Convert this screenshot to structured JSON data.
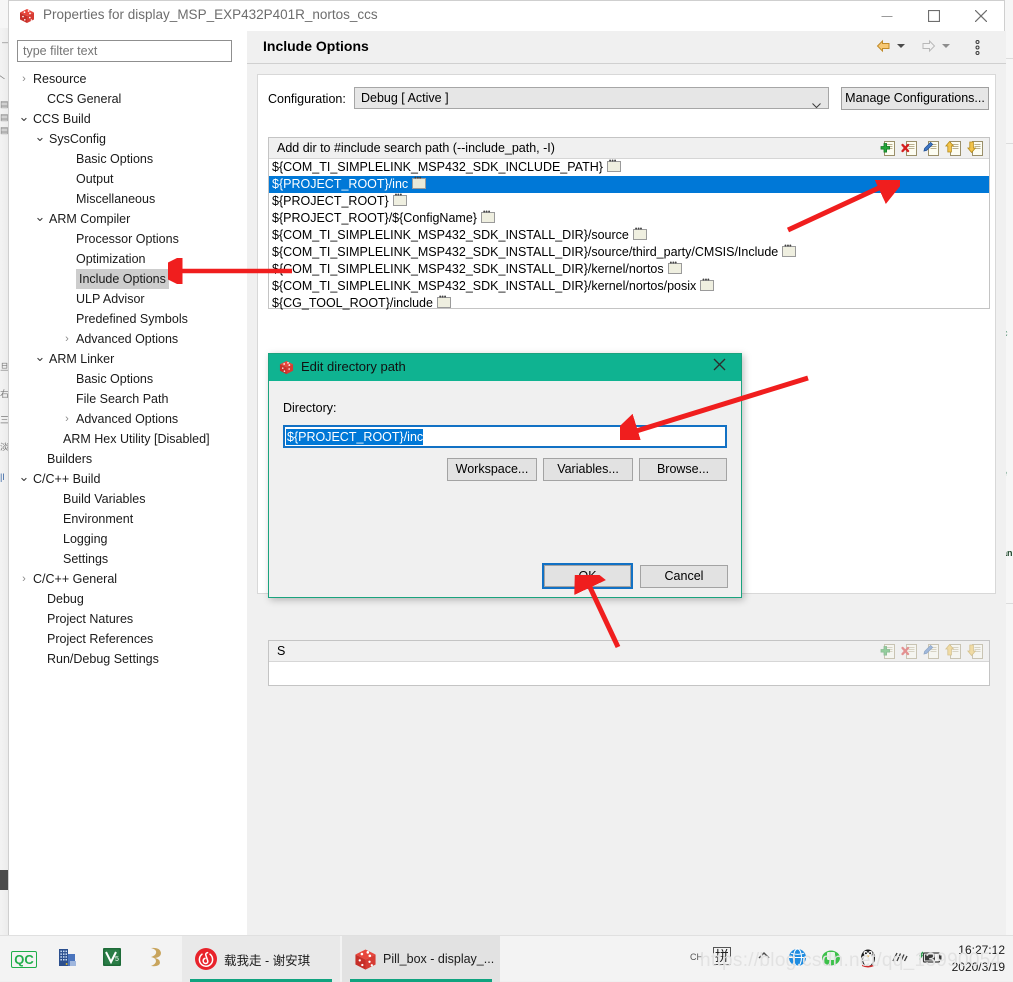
{
  "window": {
    "title": "Properties for display_MSP_EXP432P401R_nortos_ccs",
    "icon": "ccs-cube-icon",
    "minimize_label": "Minimize",
    "maximize_label": "Maximize",
    "close_label": "Close"
  },
  "filter": {
    "placeholder": "type filter text",
    "value": ""
  },
  "tree": [
    {
      "label": "Resource",
      "indent": 24,
      "twisty": "›",
      "selected": false
    },
    {
      "label": "CCS General",
      "indent": 38,
      "twisty": "",
      "selected": false
    },
    {
      "label": "CCS Build",
      "indent": 24,
      "twisty": "⌄",
      "selected": false
    },
    {
      "label": "SysConfig",
      "indent": 40,
      "twisty": "⌄",
      "selected": false
    },
    {
      "label": "Basic Options",
      "indent": 67,
      "twisty": "",
      "selected": false
    },
    {
      "label": "Output",
      "indent": 67,
      "twisty": "",
      "selected": false
    },
    {
      "label": "Miscellaneous",
      "indent": 67,
      "twisty": "",
      "selected": false
    },
    {
      "label": "ARM Compiler",
      "indent": 40,
      "twisty": "⌄",
      "selected": false
    },
    {
      "label": "Processor Options",
      "indent": 67,
      "twisty": "",
      "selected": false
    },
    {
      "label": "Optimization",
      "indent": 67,
      "twisty": "",
      "selected": false
    },
    {
      "label": "Include Options",
      "indent": 67,
      "twisty": "",
      "selected": true
    },
    {
      "label": "ULP Advisor",
      "indent": 67,
      "twisty": "",
      "selected": false
    },
    {
      "label": "Predefined Symbols",
      "indent": 67,
      "twisty": "",
      "selected": false
    },
    {
      "label": "Advanced Options",
      "indent": 67,
      "twisty": "›",
      "selected": false
    },
    {
      "label": "ARM Linker",
      "indent": 40,
      "twisty": "⌄",
      "selected": false
    },
    {
      "label": "Basic Options",
      "indent": 67,
      "twisty": "",
      "selected": false
    },
    {
      "label": "File Search Path",
      "indent": 67,
      "twisty": "",
      "selected": false
    },
    {
      "label": "Advanced Options",
      "indent": 67,
      "twisty": "›",
      "selected": false
    },
    {
      "label": "ARM Hex Utility  [Disabled]",
      "indent": 54,
      "twisty": "",
      "selected": false
    },
    {
      "label": "Builders",
      "indent": 38,
      "twisty": "",
      "selected": false
    },
    {
      "label": "C/C++ Build",
      "indent": 24,
      "twisty": "⌄",
      "selected": false
    },
    {
      "label": "Build Variables",
      "indent": 54,
      "twisty": "",
      "selected": false
    },
    {
      "label": "Environment",
      "indent": 54,
      "twisty": "",
      "selected": false
    },
    {
      "label": "Logging",
      "indent": 54,
      "twisty": "",
      "selected": false
    },
    {
      "label": "Settings",
      "indent": 54,
      "twisty": "",
      "selected": false
    },
    {
      "label": "C/C++ General",
      "indent": 24,
      "twisty": "›",
      "selected": false
    },
    {
      "label": "Debug",
      "indent": 38,
      "twisty": "",
      "selected": false
    },
    {
      "label": "Project Natures",
      "indent": 38,
      "twisty": "",
      "selected": false
    },
    {
      "label": "Project References",
      "indent": 38,
      "twisty": "",
      "selected": false
    },
    {
      "label": "Run/Debug Settings",
      "indent": 38,
      "twisty": "",
      "selected": false
    }
  ],
  "page": {
    "title": "Include Options",
    "nav_back_icon": "back-arrow-icon",
    "nav_forward_icon": "forward-arrow-icon",
    "menu_icon": "view-menu-icon"
  },
  "configuration": {
    "label": "Configuration:",
    "value": "Debug  [ Active ]",
    "manage_button": "Manage Configurations..."
  },
  "include_list": {
    "header": "Add dir to #include search path (--include_path, -I)",
    "toolbar": [
      {
        "name": "add-path-icon",
        "tip": "Add"
      },
      {
        "name": "delete-path-icon",
        "tip": "Delete"
      },
      {
        "name": "edit-path-icon",
        "tip": "Edit"
      },
      {
        "name": "move-up-icon",
        "tip": "Move up"
      },
      {
        "name": "move-down-icon",
        "tip": "Move down"
      }
    ],
    "rows": [
      {
        "text": "${COM_TI_SIMPLELINK_MSP432_SDK_INCLUDE_PATH}",
        "selected": false
      },
      {
        "text": "${PROJECT_ROOT}/inc",
        "selected": true
      },
      {
        "text": "${PROJECT_ROOT}",
        "selected": false
      },
      {
        "text": "${PROJECT_ROOT}/${ConfigName}",
        "selected": false
      },
      {
        "text": "${COM_TI_SIMPLELINK_MSP432_SDK_INSTALL_DIR}/source",
        "selected": false
      },
      {
        "text": "${COM_TI_SIMPLELINK_MSP432_SDK_INSTALL_DIR}/source/third_party/CMSIS/Include",
        "selected": false
      },
      {
        "text": "${COM_TI_SIMPLELINK_MSP432_SDK_INSTALL_DIR}/kernel/nortos",
        "selected": false
      },
      {
        "text": "${COM_TI_SIMPLELINK_MSP432_SDK_INSTALL_DIR}/kernel/nortos/posix",
        "selected": false
      },
      {
        "text": "${CG_TOOL_ROOT}/include",
        "selected": false
      }
    ]
  },
  "lower_list": {
    "header": "S",
    "toolbar": [
      {
        "name": "add-path-icon",
        "tip": "Add"
      },
      {
        "name": "delete-path-icon",
        "tip": "Delete"
      },
      {
        "name": "edit-path-icon",
        "tip": "Edit"
      },
      {
        "name": "move-up-icon",
        "tip": "Move up"
      },
      {
        "name": "move-down-icon",
        "tip": "Move down"
      }
    ]
  },
  "dialog": {
    "title": "Edit directory path",
    "icon": "ccs-cube-icon",
    "close_label": "Close",
    "directory_label": "Directory:",
    "directory_value": "${PROJECT_ROOT}/inc",
    "workspace_button": "Workspace...",
    "variables_button": "Variables...",
    "browse_button": "Browse...",
    "ok_button": "OK",
    "cancel_button": "Cancel"
  },
  "annotations": {
    "color": "#f01e1e",
    "arrows": [
      "points-to-add-path-icon",
      "points-to-include-options-tree-item",
      "points-to-directory-input",
      "points-to-ok-button"
    ]
  },
  "taskbar": {
    "items": [
      {
        "name": "qc-icon",
        "label": "QC"
      },
      {
        "name": "building-icon",
        "label": ""
      },
      {
        "name": "v5-icon",
        "label": ""
      },
      {
        "name": "gold-app-icon",
        "label": ""
      }
    ],
    "apps": [
      {
        "name": "netease-music",
        "label": "载我走 - 谢安琪",
        "active": true
      },
      {
        "name": "ccs-window",
        "label": "Pill_box - display_...",
        "active": true
      }
    ],
    "tray": [
      {
        "name": "lang-ch-indicator",
        "label": "CH"
      },
      {
        "name": "ime-pinyin-icon",
        "label": "拼"
      },
      {
        "name": "show-hidden-icons-chevron",
        "label": ""
      },
      {
        "name": "globe-icon",
        "label": ""
      },
      {
        "name": "green-shield-icon",
        "label": ""
      },
      {
        "name": "qq-penguin-icon",
        "label": ""
      },
      {
        "name": "wifi-icon",
        "label": ""
      },
      {
        "name": "battery-icon",
        "label": ""
      }
    ],
    "clock_time": "16:27:12",
    "clock_date": "2020/3/19"
  },
  "watermark": "https://blog.csdn.net/qq_13990054"
}
